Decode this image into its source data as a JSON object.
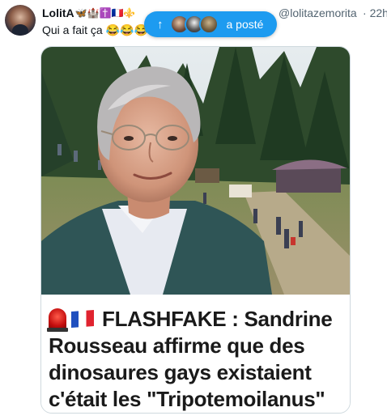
{
  "author": {
    "name": "LolitA",
    "emojis": "🦋🏰✝️🇫🇷⚜️",
    "handle": "@lolitazemorita",
    "separator": "·",
    "time": "22h"
  },
  "post": {
    "text": "Qui a fait ça 😂😂😂"
  },
  "new_posts_pill": {
    "arrow": "↑",
    "label": "a posté"
  },
  "media": {
    "caption_lines": [
      "FLASHFAKE : Sandrine",
      "Rousseau affirme que des",
      "dinosaures gays existaient",
      "c'était les \"Tripotemoilanus\""
    ]
  },
  "colors": {
    "accent": "#1d9bf0",
    "secondary_text": "#536471"
  }
}
